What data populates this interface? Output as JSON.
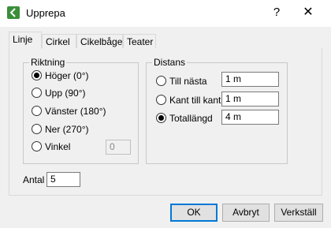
{
  "window": {
    "title": "Upprepa",
    "help": "?",
    "close": "✕"
  },
  "tabs": [
    "Linje",
    "Cirkel",
    "Cikelbåge",
    "Teater"
  ],
  "direction": {
    "label": "Riktning",
    "options": [
      {
        "label": "Höger (0°)",
        "checked": true
      },
      {
        "label": "Upp (90°)",
        "checked": false
      },
      {
        "label": "Vänster (180°)",
        "checked": false
      },
      {
        "label": "Ner (270°)",
        "checked": false
      },
      {
        "label": "Vinkel",
        "checked": false
      }
    ],
    "angle_value": "0"
  },
  "distance": {
    "label": "Distans",
    "options": [
      {
        "label": "Till nästa",
        "value": "1 m",
        "checked": false
      },
      {
        "label": "Kant till kant",
        "value": "1 m",
        "checked": false
      },
      {
        "label": "Totallängd",
        "value": "4 m",
        "checked": true
      }
    ]
  },
  "count": {
    "label": "Antal",
    "value": "5"
  },
  "buttons": {
    "ok": "OK",
    "cancel": "Avbryt",
    "settings": "Verkställ"
  }
}
